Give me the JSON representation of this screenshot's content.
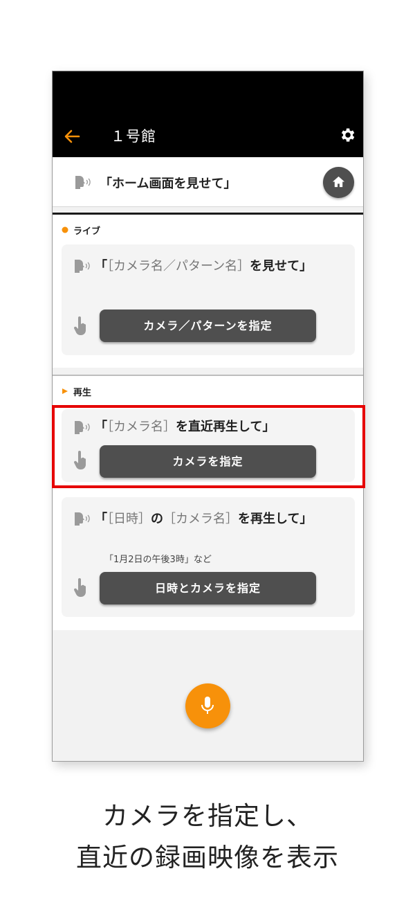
{
  "header": {
    "title": "１号館"
  },
  "home_command": {
    "phrase": "「ホーム画面を見せて」"
  },
  "live": {
    "label": "ライブ",
    "command": {
      "open": "「",
      "placeholder": "［カメラ名／パターン名］",
      "rest": "を見せて」"
    },
    "button_label": "カメラ／パターンを指定"
  },
  "playback": {
    "label": "再生",
    "recent": {
      "open": "「",
      "placeholder": "［カメラ名］",
      "rest": "を直近再生して」",
      "button_label": "カメラを指定"
    },
    "datetime": {
      "open": "「",
      "placeholder1": "［日時］",
      "mid": "の",
      "placeholder2": "［カメラ名］",
      "rest": "を再生して」",
      "example": "「1月2日の午後3時」など",
      "button_label": "日時とカメラを指定"
    }
  },
  "caption": {
    "line1": "カメラを指定し、",
    "line2": "直近の録画映像を表示"
  },
  "colors": {
    "accent": "#f7910a",
    "header_bg": "#000000",
    "button_bg": "#4f4f4f",
    "highlight": "#e60000"
  },
  "icons": {
    "back": "arrow-left-icon",
    "settings": "gear-icon",
    "home": "home-icon",
    "speak": "speaking-head-icon",
    "tap": "tap-finger-icon",
    "mic": "microphone-icon"
  }
}
